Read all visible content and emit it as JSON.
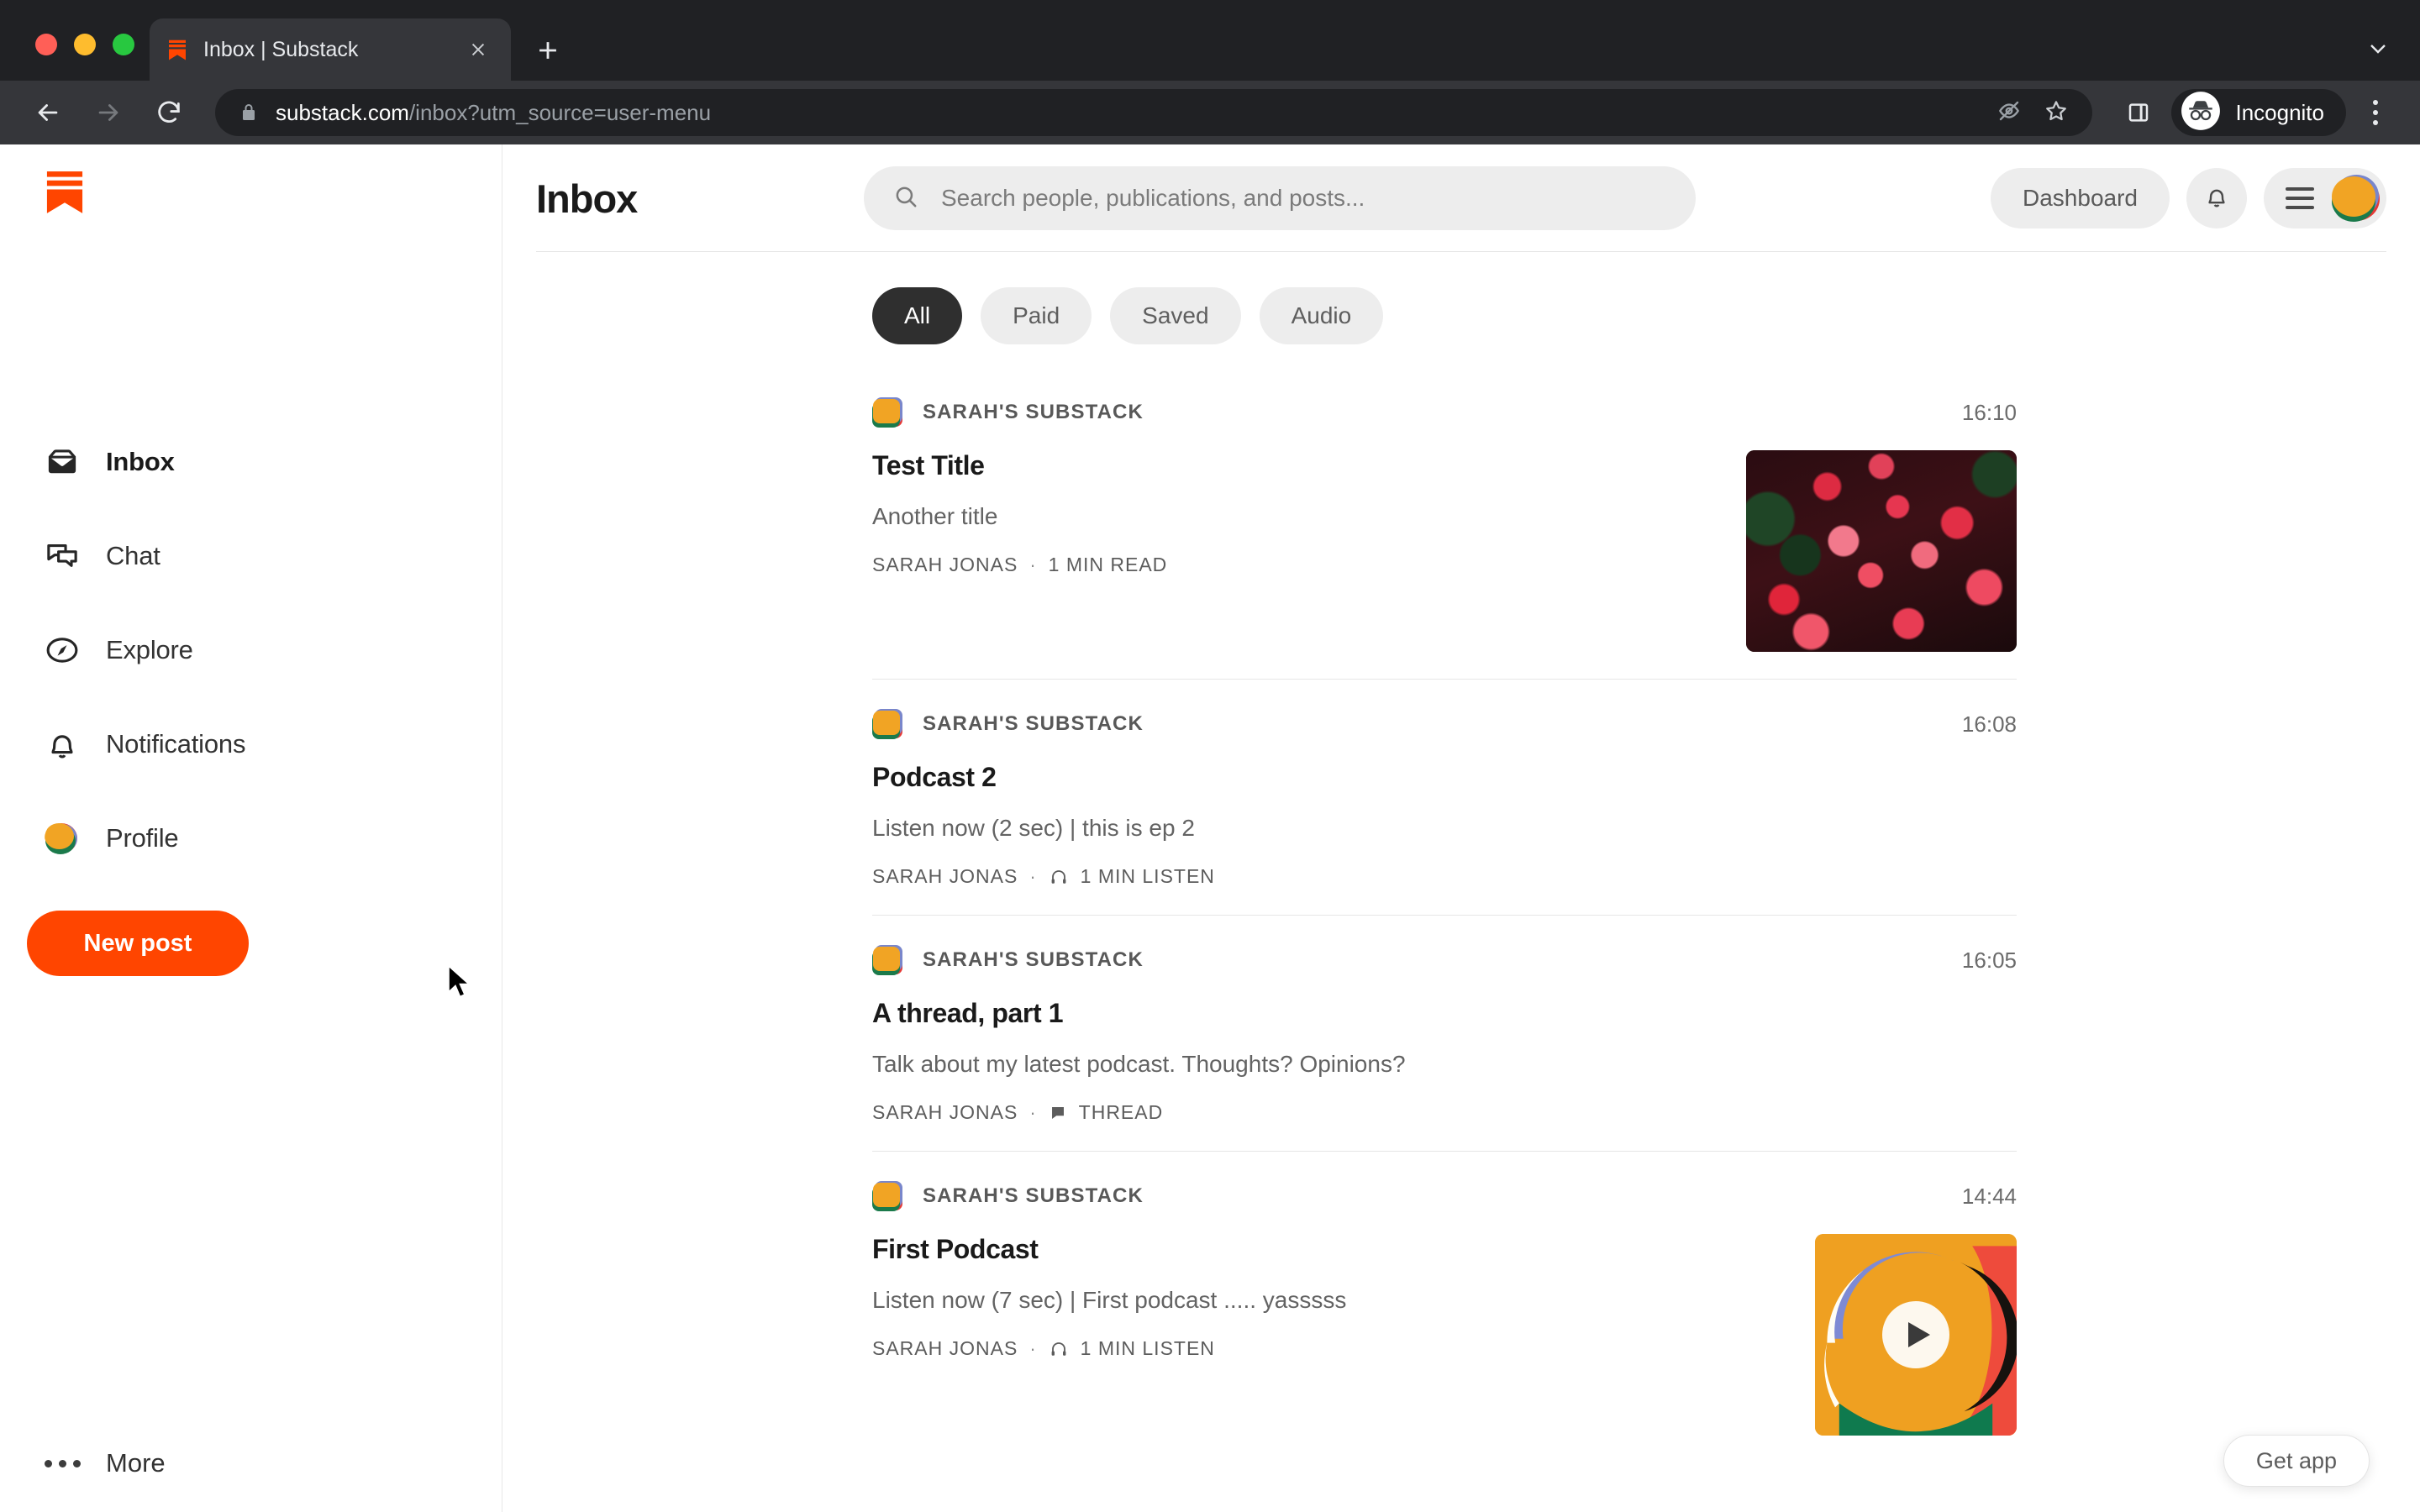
{
  "browser": {
    "tab": {
      "title": "Inbox | Substack",
      "favicon_icon": "substack-favicon",
      "close_icon": "close-icon"
    },
    "new_tab_icon": "plus-icon",
    "tab_list_chevron_icon": "chevron-down-icon",
    "back_icon": "arrow-left-icon",
    "forward_icon": "arrow-right-icon",
    "reload_icon": "reload-icon",
    "lock_icon": "lock-icon",
    "url_domain": "substack.com",
    "url_path": "/inbox?utm_source=user-menu",
    "omni_actions": [
      "eye-off-icon",
      "star-icon"
    ],
    "side_panel_icon": "side-panel-icon",
    "incognito_icon": "incognito-icon",
    "incognito_label": "Incognito",
    "menu_icon": "kebab-menu-icon"
  },
  "sidebar": {
    "logo_icon": "substack-logo-icon",
    "items": [
      {
        "label": "Inbox",
        "icon": "inbox-icon",
        "active": true
      },
      {
        "label": "Chat",
        "icon": "chat-bubbles-icon",
        "active": false
      },
      {
        "label": "Explore",
        "icon": "compass-icon",
        "active": false
      },
      {
        "label": "Notifications",
        "icon": "bell-icon",
        "active": false
      },
      {
        "label": "Profile",
        "icon": "avatar-icon",
        "active": false
      }
    ],
    "new_post_label": "New post",
    "more_label": "More",
    "more_icon": "ellipsis-icon"
  },
  "header": {
    "title": "Inbox",
    "search": {
      "placeholder": "Search people, publications, and posts...",
      "value": "",
      "icon": "search-icon"
    },
    "dashboard_label": "Dashboard",
    "notifications_icon": "bell-icon",
    "hamburger_icon": "hamburger-icon",
    "avatar_icon": "user-avatar"
  },
  "filters": {
    "chips": [
      {
        "label": "All",
        "active": true
      },
      {
        "label": "Paid",
        "active": false
      },
      {
        "label": "Saved",
        "active": false
      },
      {
        "label": "Audio",
        "active": false
      }
    ]
  },
  "feed": {
    "posts": [
      {
        "publication": "SARAH'S SUBSTACK",
        "time": "16:10",
        "title": "Test Title",
        "subtitle": "Another title",
        "author": "SARAH JONAS",
        "separator": "·",
        "meta": "1 MIN READ",
        "meta_icon": "",
        "thumb_type": "image",
        "thumb_name": "floral-photo-thumbnail"
      },
      {
        "publication": "SARAH'S SUBSTACK",
        "time": "16:08",
        "title": "Podcast 2",
        "subtitle": "Listen now (2 sec) | this is ep 2",
        "author": "SARAH JONAS",
        "separator": "·",
        "meta": "1 MIN LISTEN",
        "meta_icon": "headphones-icon",
        "thumb_type": "none",
        "thumb_name": ""
      },
      {
        "publication": "SARAH'S SUBSTACK",
        "time": "16:05",
        "title": "A thread, part 1",
        "subtitle": "Talk about my latest podcast. Thoughts? Opinions?",
        "author": "SARAH JONAS",
        "separator": "·",
        "meta": "THREAD",
        "meta_icon": "comment-icon",
        "thumb_type": "none",
        "thumb_name": ""
      },
      {
        "publication": "SARAH'S SUBSTACK",
        "time": "14:44",
        "title": "First Podcast",
        "subtitle": "Listen now (7 sec) | First podcast ..... yasssss",
        "author": "SARAH JONAS",
        "separator": "·",
        "meta": "1 MIN LISTEN",
        "meta_icon": "headphones-icon",
        "thumb_type": "podcast",
        "thumb_name": "podcast-cover-play-thumbnail"
      }
    ]
  },
  "footer": {
    "get_app_label": "Get app"
  },
  "colors": {
    "brand_orange": "#FF4500",
    "chip_active_bg": "#2f2f2f",
    "chip_bg": "#ededed",
    "browser_tabstrip": "#202124",
    "browser_toolbar": "#35363a",
    "divider": "#e6e6e6",
    "text_primary": "#1a1a1a",
    "text_secondary": "#636363"
  }
}
